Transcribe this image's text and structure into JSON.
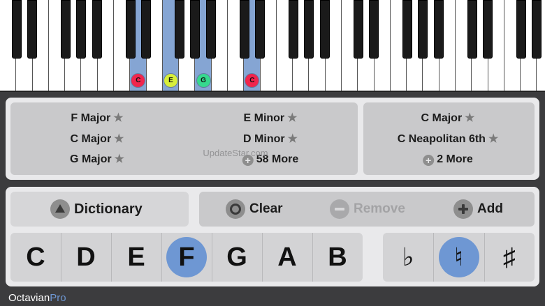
{
  "keyboard": {
    "highlight_color": "#85a5d3",
    "note_markers": [
      {
        "label": "C",
        "color": "#f0254d"
      },
      {
        "label": "E",
        "color": "#d8ef3a"
      },
      {
        "label": "G",
        "color": "#36d98e"
      },
      {
        "label": "C",
        "color": "#f0254d"
      }
    ]
  },
  "chords": {
    "left_col1": [
      "F Major",
      "C Major",
      "G Major"
    ],
    "left_col2": [
      "E Minor",
      "D Minor"
    ],
    "left_more": "58 More",
    "right_col": [
      "C Major",
      "C Neapolitan 6th"
    ],
    "right_more": "2 More",
    "star": "★",
    "plus": "+"
  },
  "watermark": "UpdateStar.com",
  "controls": {
    "dictionary": "Dictionary",
    "clear": "Clear",
    "remove": "Remove",
    "add": "Add"
  },
  "notes": [
    "C",
    "D",
    "E",
    "F",
    "G",
    "A",
    "B"
  ],
  "selected_note": "F",
  "accidentals": [
    "♭",
    "♮",
    "♯"
  ],
  "selected_accidental": "♮",
  "app": {
    "name_part1": "Octavian",
    "name_part2": "Pro",
    "accent": "#6e97d3"
  }
}
